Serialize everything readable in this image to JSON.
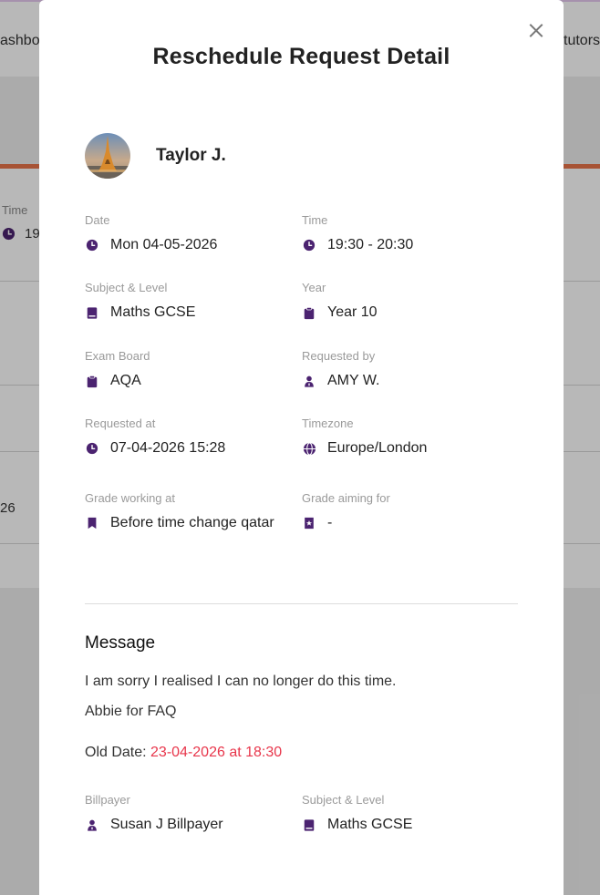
{
  "background": {
    "nav_left": "ashbo",
    "nav_right": "tutors",
    "time_label": "Time",
    "time_value": "19",
    "date_fragment": "26"
  },
  "modal": {
    "title": "Reschedule Request Detail",
    "tutor_name": "Taylor J.",
    "fields": {
      "date": {
        "label": "Date",
        "value": "Mon 04-05-2026",
        "icon": "clock-icon"
      },
      "time": {
        "label": "Time",
        "value": "19:30 - 20:30",
        "icon": "clock-icon"
      },
      "subject_level": {
        "label": "Subject & Level",
        "value": "Maths GCSE",
        "icon": "book-icon"
      },
      "year": {
        "label": "Year",
        "value": "Year 10",
        "icon": "clipboard-icon"
      },
      "exam_board": {
        "label": "Exam Board",
        "value": "AQA",
        "icon": "clipboard-icon"
      },
      "requested_by": {
        "label": "Requested by",
        "value": "AMY W.",
        "icon": "person-icon"
      },
      "requested_at": {
        "label": "Requested at",
        "value": "07-04-2026 15:28",
        "icon": "clock-icon"
      },
      "timezone": {
        "label": "Timezone",
        "value": "Europe/London",
        "icon": "globe-icon"
      },
      "grade_working_at": {
        "label": "Grade working at",
        "value": "Before time change qatar",
        "icon": "bookmark-icon"
      },
      "grade_aiming_for": {
        "label": "Grade aiming for",
        "value": "-",
        "icon": "bookmark-star-icon"
      }
    },
    "message": {
      "title": "Message",
      "lines": [
        "I am sorry I realised I can no longer do this time.",
        "Abbie for FAQ"
      ],
      "old_date_label": "Old Date: ",
      "old_date_value": "23-04-2026 at 18:30"
    },
    "footer_fields": {
      "billpayer": {
        "label": "Billpayer",
        "value": "Susan J Billpayer",
        "icon": "person-icon"
      },
      "subject_level": {
        "label": "Subject & Level",
        "value": "Maths GCSE",
        "icon": "book-icon"
      }
    }
  },
  "colors": {
    "icon": "#4b2370",
    "accent_red": "#e8364b",
    "orange_rule": "#e8744a"
  }
}
